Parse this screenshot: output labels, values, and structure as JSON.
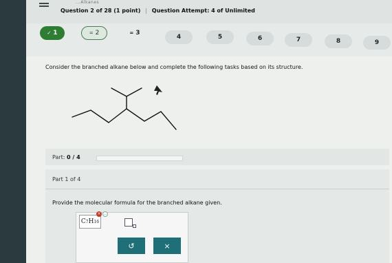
{
  "header": {
    "crumb": "...Alkanes",
    "question_info": "Question 2 of 28 (1 point)",
    "attempt_info": "Question Attempt: 4 of Unlimited",
    "separator": "|"
  },
  "question_nav": {
    "items": [
      {
        "label": "1",
        "prefix": "✓",
        "state": "done"
      },
      {
        "label": "2",
        "prefix": "=",
        "state": "partial"
      },
      {
        "label": "3",
        "prefix": "=",
        "state": "plain"
      },
      {
        "label": "4",
        "prefix": "",
        "state": "default"
      },
      {
        "label": "5",
        "prefix": "",
        "state": "default"
      },
      {
        "label": "6",
        "prefix": "",
        "state": "default"
      },
      {
        "label": "7",
        "prefix": "",
        "state": "default"
      },
      {
        "label": "8",
        "prefix": "",
        "state": "default"
      },
      {
        "label": "9",
        "prefix": "",
        "state": "default"
      }
    ]
  },
  "prompt": "Consider the branched alkane below and complete the following tasks based on its structure.",
  "part_bar": {
    "label": "Part:",
    "value": "0 / 4"
  },
  "part_panel": {
    "part_of": "Part 1 of 4",
    "question": "Provide the molecular formula for the branched alkane given.",
    "formula": {
      "c": "C",
      "c_sub": "7",
      "h": "H",
      "h_sub": "16"
    },
    "error_badge": "×",
    "more_badge": "..."
  },
  "buttons": {
    "undo": "↺",
    "clear": "×"
  },
  "colors": {
    "done": "#2e7d32",
    "action": "#1f6f79"
  }
}
